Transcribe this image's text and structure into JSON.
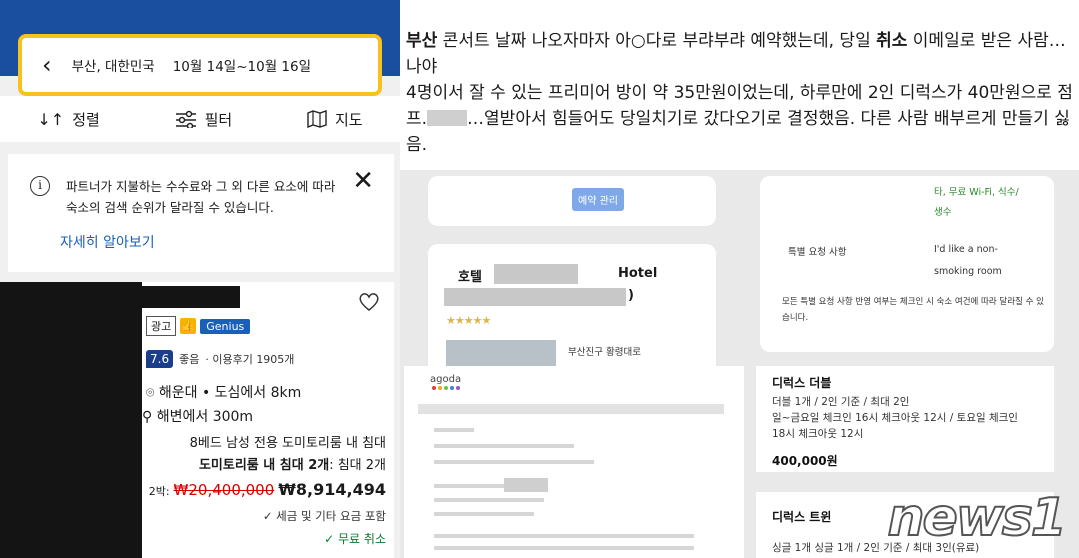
{
  "left": {
    "search": {
      "location": "부산, 대한민국",
      "dates": "10월 14일~10월 16일"
    },
    "toolbar": {
      "sort_label": "정렬",
      "filter_label": "필터",
      "map_label": "지도"
    },
    "notice": {
      "text": "파트너가 지불하는 수수료와 그 외 다른 요소에 따라 숙소의 검색 순위가 달라질 수 있습니다.",
      "link": "자세히 알아보기"
    },
    "card": {
      "badge_ad": "광고",
      "badge_genius": "Genius",
      "score": "7.6",
      "score_word": "좋음",
      "reviews": "· 이용후기 1905개",
      "location": "해운대 • 도심에서 8km",
      "beach": "해변에서 300m",
      "room_line1": "8베드 남성 전용 도미토리룸 내 침대",
      "room_line2_bold": "도미토리룸 내 침대 2개",
      "room_line2_rest": ": 침대 2개",
      "nights": "2박:",
      "old_price": "₩20,400,000",
      "new_price": "₩8,914,494",
      "tax": "✓ 세금 및 기타 요금 포함",
      "free_cancel": "✓ 무료 취소"
    }
  },
  "right": {
    "p1_bold1": "부산",
    "p1_mid": " 콘서트 날짜 나오자마자 아○다로 부랴부랴 예약했는데, 당일 ",
    "p1_bold2": "취소",
    "p1_end": " 이메일로 받은 사람…나야",
    "p2_start": "4명이서 잘 수 있는 프리미어 방이 약 35만원이었는데, 하루만에 2인 디럭스가 40만원으로 점프.",
    "p2_end": "…열받아서 힘들어도 당일치기로 갔다오기로 결정했음. 다른 사람 배부르게 만들기 싫음."
  },
  "shots": {
    "manage_button": "예약 관리",
    "hotel_prefix": "호텔",
    "hotel_suffix": "Hotel",
    "hotel_paren": ")",
    "address": "부산진구 황령대로",
    "wifi_line": "타, 무료 Wi-Fi, 식수/",
    "wifi_line2": "생수",
    "special_label": "특별 요청 사항",
    "special_value": "I'd like a non-",
    "special_value2": "smoking room",
    "special_note": "모든 특별 요청 사항 반영 여부는 체크인 시 숙소 여건에 따라 달라질 수 있습니다.",
    "agoda_logo": "agoda",
    "deluxe_title": "디럭스 더블",
    "deluxe_l1": "더블 1개 / 2인 기준 / 최대 2인",
    "deluxe_l2": "일~금요일 체크인 16시 체크아웃 12시 / 토요일 체크인",
    "deluxe_l3": "18시 체크아웃 12시",
    "deluxe_price": "400,000원",
    "deluxe2_title": "디럭스 트윈",
    "deluxe2_l1": "싱글 1개 싱글 1개 / 2인 기준 / 최대 3인(유료)",
    "watermark": "news1"
  }
}
